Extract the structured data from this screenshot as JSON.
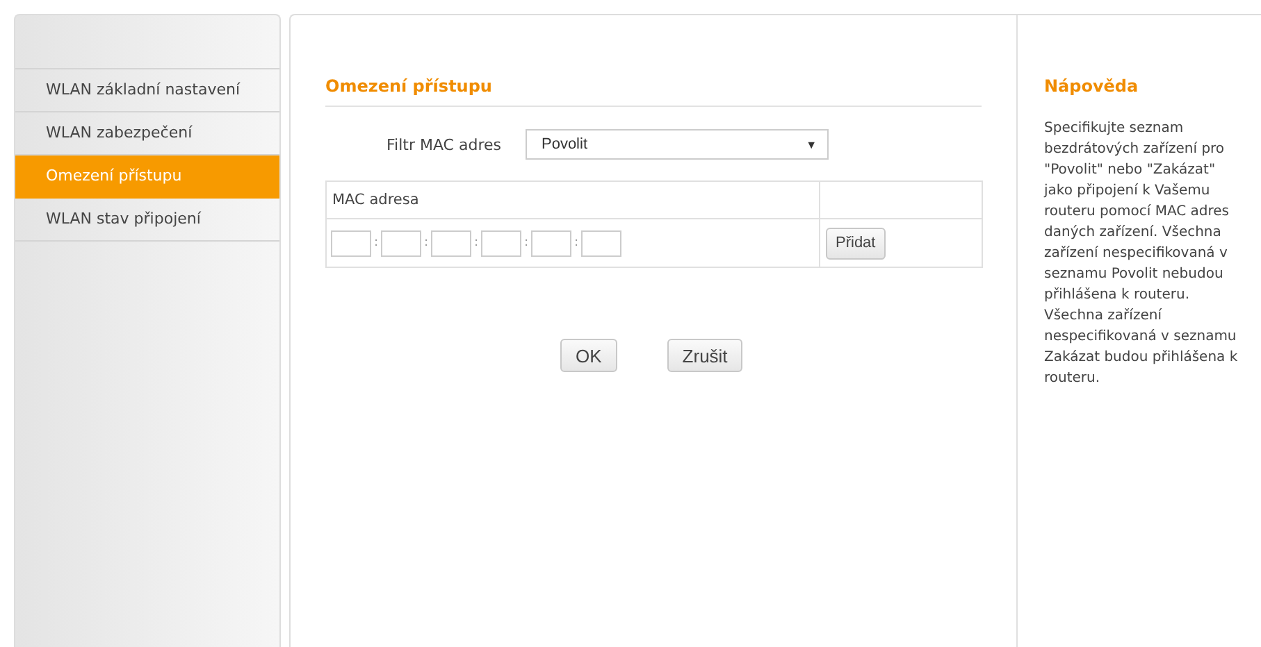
{
  "sidebar": {
    "items": [
      {
        "label": "WLAN základní nastavení",
        "selected": false
      },
      {
        "label": "WLAN zabezpečení",
        "selected": false
      },
      {
        "label": "Omezení přístupu",
        "selected": true
      },
      {
        "label": "WLAN stav připojení",
        "selected": false
      }
    ]
  },
  "main": {
    "title": "Omezení přístupu",
    "filter": {
      "label": "Filtr MAC adres",
      "value": "Povolit",
      "arrow": "▼"
    },
    "table": {
      "columns": [
        "MAC adresa"
      ],
      "separators": [
        ":",
        ":",
        ":",
        ":",
        ":"
      ],
      "add_button": "Přidat"
    },
    "buttons": [
      "OK",
      "Zrušit"
    ]
  },
  "help": {
    "title": "Nápověda",
    "text": "Specifikujte seznam bezdrátových zařízení pro \"Povolit\" nebo \"Zakázat\" jako připojení k Vašemu routeru pomocí MAC adres daných zařízení. Všechna zařízení nespecifikovaná v seznamu Povolit nebudou přihlášena k routeru. Všechna zařízení nespecifikovaná v seznamu Zakázat budou přihlášena k routeru."
  }
}
